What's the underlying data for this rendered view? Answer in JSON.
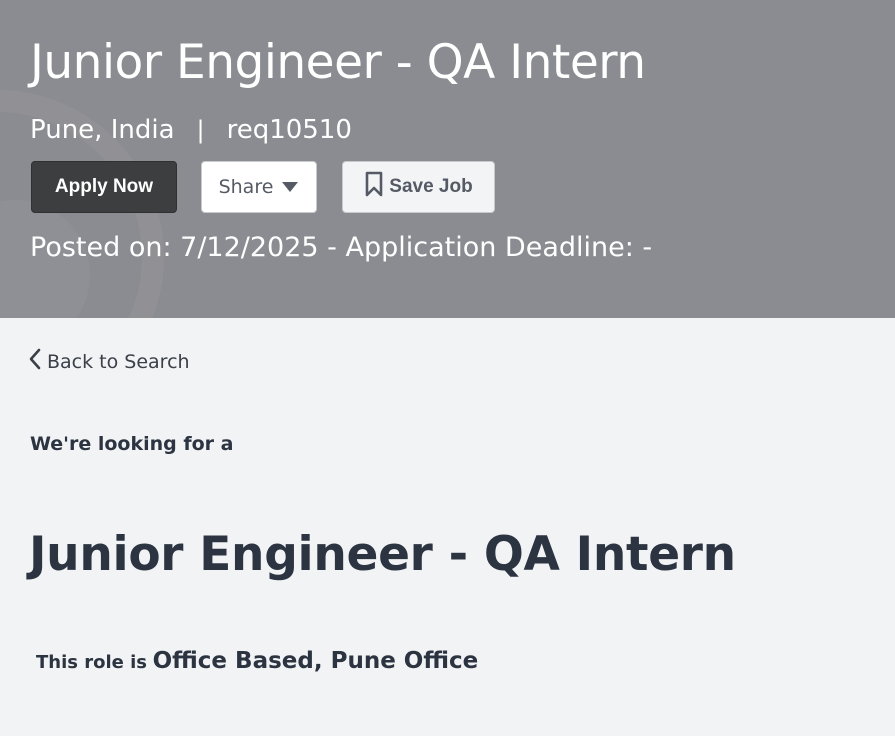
{
  "header": {
    "job_title": "Junior Engineer - QA Intern",
    "location": "Pune, India",
    "separator": "|",
    "req_id": "req10510",
    "posted_line": "Posted on: 7/12/2025 - Application Deadline: -",
    "background_color": "#8b8c91"
  },
  "actions": {
    "apply_label": "Apply Now",
    "share_label": "Share",
    "share_icon": "caret-down-icon",
    "save_label": "Save Job",
    "save_icon": "bookmark-icon"
  },
  "nav": {
    "back_label": "Back to Search",
    "back_icon": "chevron-left-icon"
  },
  "body": {
    "lead_text": "We're looking for a",
    "title": "Junior Engineer - QA Intern",
    "role_prefix": "This role is",
    "role_value": "Office Based, Pune Office",
    "text_color": "#2c3442"
  }
}
